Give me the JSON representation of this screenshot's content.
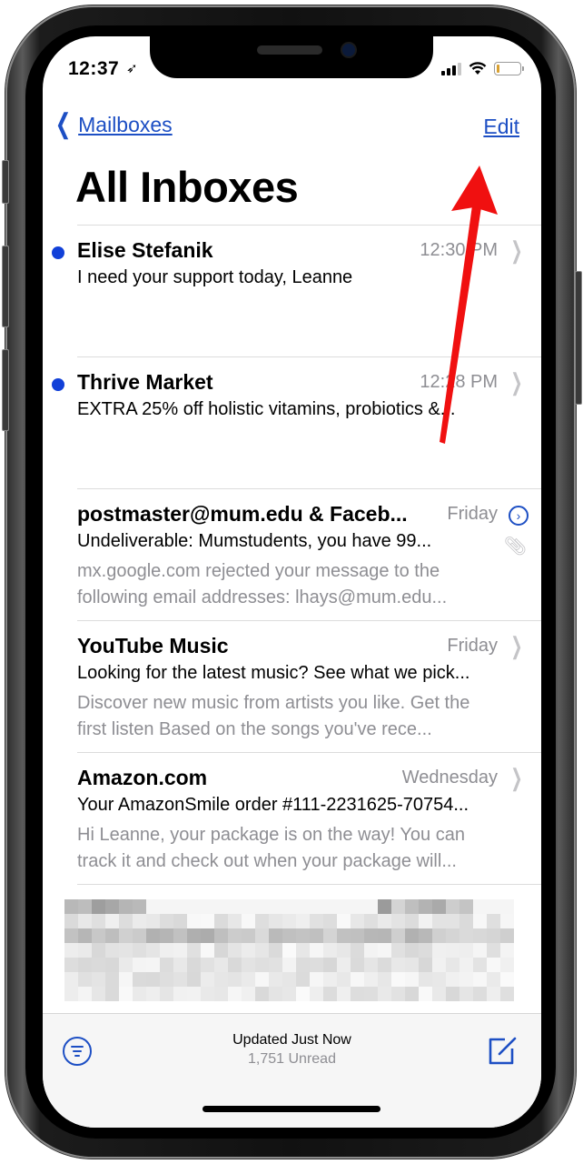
{
  "status_bar": {
    "time": "12:37",
    "location_icon": "location-arrow-icon",
    "signal_icon": "cellular-signal-icon",
    "wifi_icon": "wifi-icon",
    "battery_icon": "battery-low-icon"
  },
  "nav": {
    "back_label": "Mailboxes",
    "back_icon": "chevron-left-icon",
    "edit_label": "Edit"
  },
  "page_title": "All Inboxes",
  "emails": [
    {
      "sender": "Elise Stefanik",
      "date": "12:30 PM",
      "subject": "I need your support today, Leanne",
      "preview": "",
      "unread": true,
      "indicator": "chevron-right-icon"
    },
    {
      "sender": "Thrive Market",
      "date": "12:28 PM",
      "subject": "EXTRA 25% off holistic vitamins, probiotics &...",
      "preview": "",
      "unread": true,
      "indicator": "chevron-right-icon"
    },
    {
      "sender": "postmaster@mum.edu & Faceb...",
      "date": "Friday",
      "subject": "Undeliverable: Mumstudents, you have 99...",
      "preview": "mx.google.com rejected your message to the following email addresses: lhays@mum.edu...",
      "unread": false,
      "indicator": "thread-chevron-circle-icon",
      "attachment_icon": "paperclip-icon"
    },
    {
      "sender": "YouTube Music",
      "date": "Friday",
      "subject": "Looking for the latest music? See what we pick...",
      "preview": "Discover new music from artists you like. Get the first listen Based on the songs you've rece...",
      "unread": false,
      "indicator": "chevron-right-icon"
    },
    {
      "sender": "Amazon.com",
      "date": "Wednesday",
      "subject": "Your AmazonSmile order #111-2231625-70754...",
      "preview": "Hi Leanne, your package is on the way! You can track it and check out when your package will...",
      "unread": false,
      "indicator": "chevron-right-icon"
    }
  ],
  "blurred_row": {
    "label": "pixelated-email-row"
  },
  "toolbar": {
    "filter_icon": "filter-circle-icon",
    "status": "Updated Just Now",
    "unread_count": "1,751 Unread",
    "compose_icon": "compose-icon"
  },
  "annotation": {
    "arrow_color": "#f01010",
    "points_to": "Edit"
  },
  "colors": {
    "accent": "#1d4fc4",
    "unread_dot": "#1140d8",
    "secondary_text": "#8e8e93"
  }
}
